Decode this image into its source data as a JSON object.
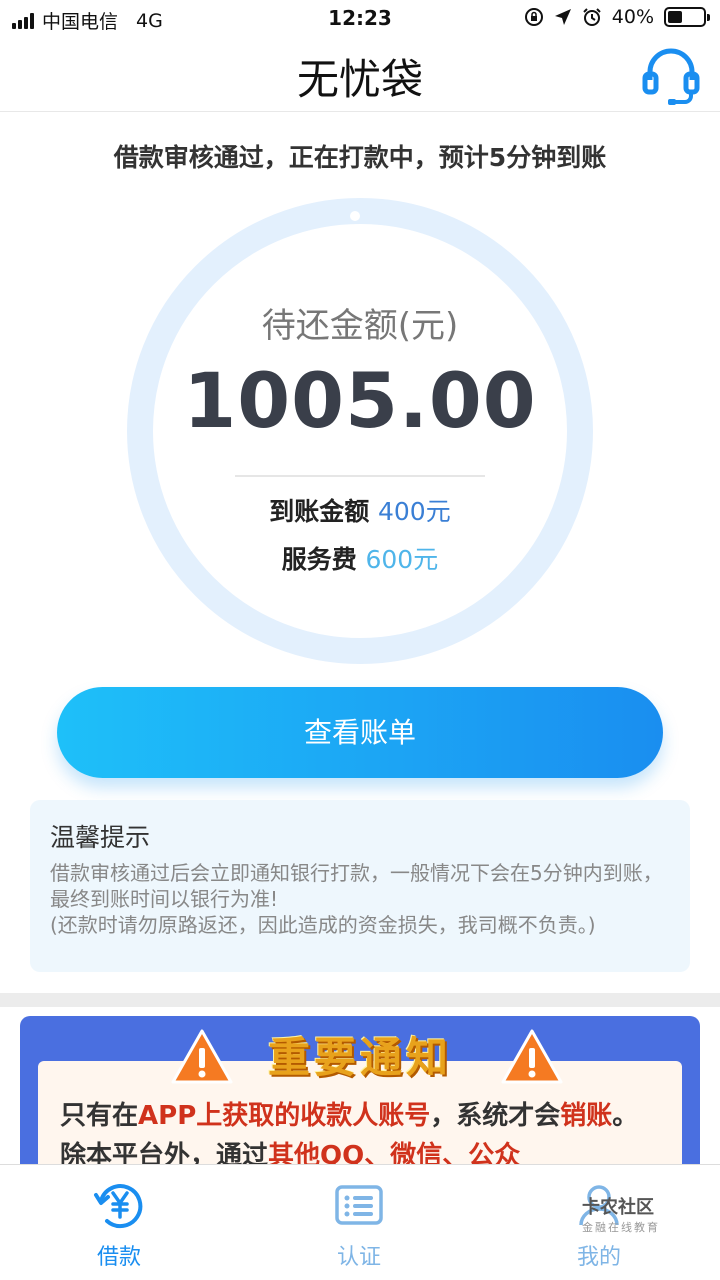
{
  "status_bar": {
    "carrier": "中国电信",
    "network": "4G",
    "time": "12:23",
    "battery": "40%",
    "battery_level": 0.4
  },
  "header": {
    "title": "无忧袋",
    "support_icon": "headset-icon"
  },
  "notice": "借款审核通过，正在打款中，预计5分钟到账",
  "ring": {
    "progress": 0.22,
    "label": "待还金额(元)",
    "amount": "1005.00",
    "received_label": "到账金额",
    "received_value": "400元",
    "fee_label": "服务费",
    "fee_value": "600元"
  },
  "bill_button": "查看账单",
  "tips": {
    "title": "温馨提示",
    "line1": "借款审核通过后会立即通知银行打款，一般情况下会在5分钟内到账，最终到账时间以银行为准!",
    "line2": "(还款时请勿原路返还，因此造成的资金损失，我司概不负责。)"
  },
  "banner": {
    "title": "重要通知",
    "text_a": "只有在",
    "text_b": "APP上获取的收款人账号",
    "text_c": "，系统才会",
    "text_d": "销账",
    "text_e": "。除本平台外，通过",
    "text_f": "其他QQ、微信、公众"
  },
  "tabbar": {
    "tabs": [
      {
        "label": "借款",
        "icon": "loan-icon",
        "active": true
      },
      {
        "label": "认证",
        "icon": "id-card-icon",
        "active": false
      },
      {
        "label": "我的",
        "icon": "user-icon",
        "active": false
      }
    ]
  },
  "watermark": {
    "title": "卡农社区",
    "subtitle": "金融在线教育"
  },
  "colors": {
    "primary": "#1a8ef0",
    "accent_light": "#4fb5ea",
    "ring_track": "#e3f0fd",
    "banner_bg": "#4a6fe0",
    "warning": "#d0321c"
  }
}
